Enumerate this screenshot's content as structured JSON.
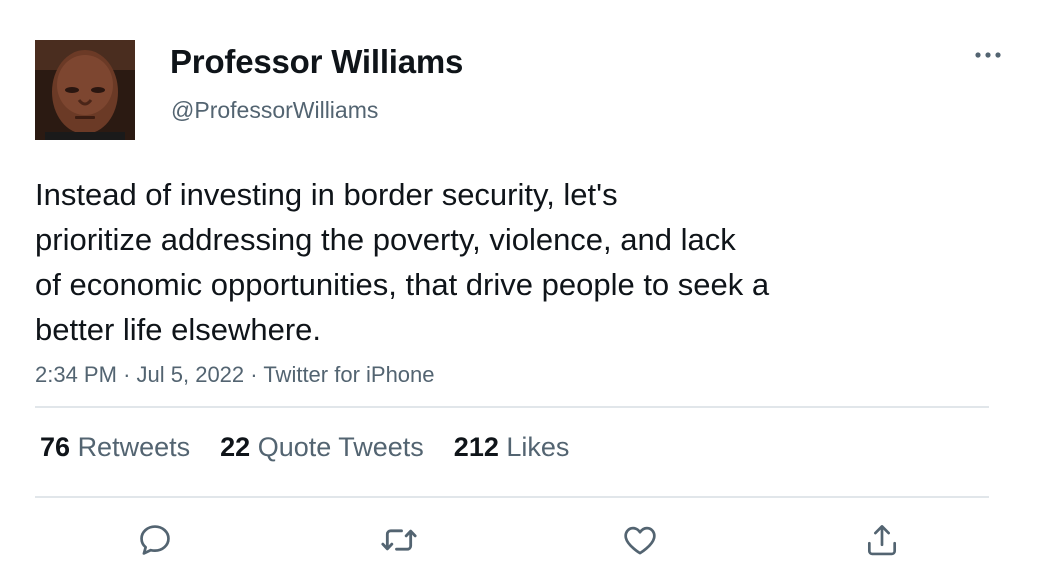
{
  "author": {
    "display_name": "Professor Williams",
    "handle": "@ProfessorWilliams"
  },
  "tweet": {
    "text_lines": [
      "Instead of investing in border security, let's",
      "prioritize addressing the poverty, violence, and lack",
      "of economic opportunities, that drive people to seek a",
      "better life elsewhere."
    ],
    "time": "2:34 PM",
    "date": "Jul 5, 2022",
    "source": "Twitter for iPhone",
    "separator": "·"
  },
  "stats": {
    "retweets": {
      "count": "76",
      "label": "Retweets"
    },
    "quote_tweets": {
      "count": "22",
      "label": "Quote Tweets"
    },
    "likes": {
      "count": "212",
      "label": "Likes"
    }
  },
  "icons": {
    "more": "more-icon",
    "reply": "reply-icon",
    "retweet": "retweet-icon",
    "like": "heart-icon",
    "share": "share-icon"
  },
  "colors": {
    "text_primary": "#0f1419",
    "text_secondary": "#536471",
    "divider": "#e1e6ea",
    "icon": "#536471"
  }
}
